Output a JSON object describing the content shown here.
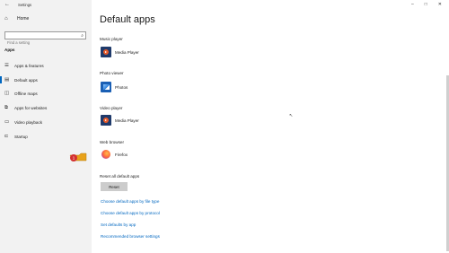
{
  "window": {
    "title": "Settings",
    "controls": [
      "–",
      "□",
      "✕"
    ]
  },
  "sidebar": {
    "home": "Home",
    "search_placeholder": "Find a setting",
    "section": "Apps",
    "items": [
      {
        "label": "Apps & features",
        "icon": "list-icon"
      },
      {
        "label": "Default apps",
        "icon": "default-apps-icon",
        "active": true
      },
      {
        "label": "Offline maps",
        "icon": "map-icon"
      },
      {
        "label": "Apps for websites",
        "icon": "link-window-icon"
      },
      {
        "label": "Video playback",
        "icon": "video-icon"
      },
      {
        "label": "Startup",
        "icon": "startup-icon"
      }
    ]
  },
  "main": {
    "title": "Default apps",
    "groups": [
      {
        "label": "Music player",
        "app": "Media Player",
        "icon": "media-player-icon"
      },
      {
        "label": "Photo viewer",
        "app": "Photos",
        "icon": "photos-icon"
      },
      {
        "label": "Video player",
        "app": "Media Player",
        "icon": "media-player-icon"
      },
      {
        "label": "Web browser",
        "app": "Firefox",
        "icon": "firefox-icon"
      }
    ],
    "reset": {
      "label": "Reset all default apps",
      "button": "Reset"
    },
    "links": [
      "Choose default apps by file type",
      "Choose default apps by protocol",
      "Set defaults by app",
      "Recommended browser settings"
    ]
  },
  "annotation": {
    "step_number": "1",
    "accent": "#e8a21a",
    "badge_color": "#d32f2f"
  }
}
